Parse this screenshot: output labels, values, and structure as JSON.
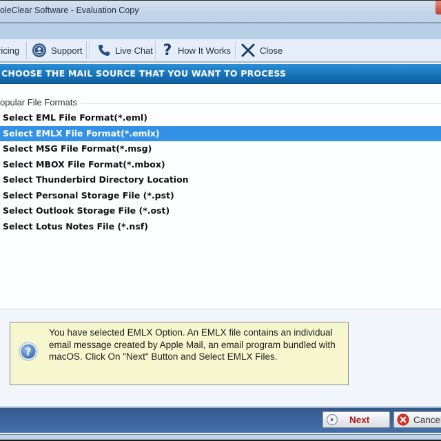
{
  "window": {
    "title": "oleClear Software - Evaluation Copy"
  },
  "toolbar": {
    "items": [
      {
        "label": "ricing",
        "icon": "price-tag-icon"
      },
      {
        "label": "Support",
        "icon": "support-user-icon"
      },
      {
        "label": "Live Chat",
        "icon": "phone-icon"
      },
      {
        "label": "How It Works",
        "icon": "question-icon"
      },
      {
        "label": "Close",
        "icon": "close-x-icon"
      }
    ]
  },
  "header": {
    "title": "CHOOSE THE MAIL SOURCE THAT YOU WANT TO PROCESS"
  },
  "source_list": {
    "group_label": "opular File Formats",
    "selected_index": 1,
    "items": [
      {
        "label": "Select EML File Format(*.eml)"
      },
      {
        "label": "Select EMLX File Format(*.emlx)"
      },
      {
        "label": "Select MSG File Format(*.msg)"
      },
      {
        "label": "Select MBOX File Format(*.mbox)"
      },
      {
        "label": "Select Thunderbird Directory Location"
      },
      {
        "label": "Select Personal Storage File (*.pst)"
      },
      {
        "label": "Select Outlook Storage File (*.ost)"
      },
      {
        "label": "Select Lotus Notes File (*.nsf)"
      }
    ]
  },
  "info": {
    "icon": "help-question-icon",
    "text": "You have selected EMLX Option. An EMLX file contains an individual email message created by Apple Mail, an email program bundled with macOS. Click On \"Next\" Button and Select EMLX Files."
  },
  "footer": {
    "next_label": "Next",
    "cancel_label": "Cancel"
  },
  "colors": {
    "header_band": "#1773b9",
    "selection": "#3391e6",
    "info_background": "#f7f7cf",
    "next_text": "#a31919",
    "footer": "#3d66a0"
  }
}
